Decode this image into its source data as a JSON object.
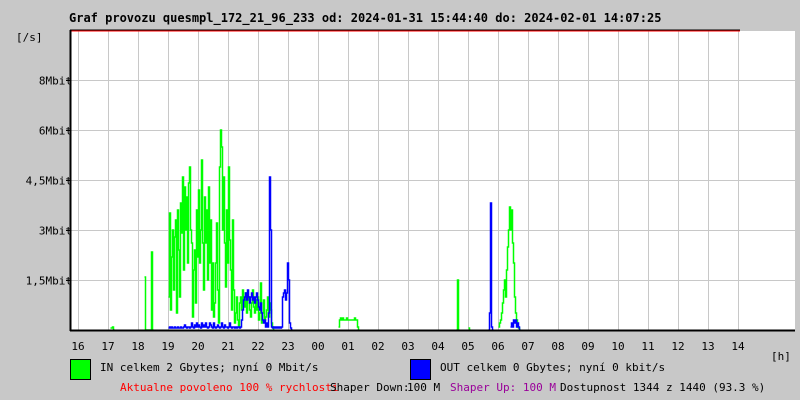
{
  "chart_data": {
    "type": "line",
    "title": "Graf provozu quesmpl_172_21_96_233 od: 2024-01-31 15:44:40 do: 2024-02-01 14:07:25",
    "ylabel": "[/s]",
    "xlabel": "[h]",
    "x_units": "hours since 16:00",
    "xlim": [
      -0.27,
      23.9
    ],
    "ylim": [
      0,
      9
    ],
    "x_ticks": [
      0,
      1,
      2,
      3,
      4,
      5,
      6,
      7,
      8,
      9,
      10,
      11,
      12,
      13,
      14,
      15,
      16,
      17,
      18,
      19,
      20,
      21,
      22
    ],
    "x_tick_labels": [
      "16",
      "17",
      "18",
      "19",
      "20",
      "21",
      "22",
      "23",
      "00",
      "01",
      "02",
      "03",
      "04",
      "05",
      "06",
      "07",
      "08",
      "09",
      "10",
      "11",
      "12",
      "13",
      "14"
    ],
    "y_ticks": [
      1.5,
      3,
      4.5,
      6,
      7.5
    ],
    "y_tick_labels": [
      "1,5Mbit",
      "3Mbit",
      "4,5Mbit",
      "6Mbit",
      "8Mbit"
    ],
    "grid": true,
    "step_hours": 0.0333,
    "series": [
      {
        "name": "IN",
        "color": "#00ff00",
        "segments": [
          {
            "start": 1.067,
            "values": [
              0.05,
              0.05,
              0.1,
              0
            ]
          },
          {
            "start": 2.2,
            "values": [
              1.59,
              0,
              0,
              0,
              0,
              0,
              0,
              2.34,
              0
            ]
          },
          {
            "start": 3.0,
            "values": [
              1.0,
              3.5,
              0.6,
              2.2,
              3.0,
              1.2,
              2.8,
              3.3,
              0.5,
              3.6,
              2.4,
              1.0,
              3.8,
              2.9,
              4.6,
              1.8,
              4.3,
              3.0,
              4.0,
              2.0,
              4.4,
              4.9,
              3.0,
              2.6,
              0.4,
              1.8,
              2.4,
              0.8,
              3.6,
              2.2,
              4.2,
              2.0,
              3.0,
              5.1,
              2.6,
              1.2,
              4.0,
              2.6,
              3.6,
              1.5,
              4.3,
              2.0,
              3.3,
              0.6,
              2.0,
              0.4,
              0.8,
              2.0,
              3.2,
              1.2,
              0.2,
              4.9,
              6.0,
              5.5,
              3.0,
              4.6,
              2.6,
              1.3,
              3.6,
              2.0,
              4.9,
              2.7,
              1.8,
              0.6,
              3.3,
              1.2,
              0.2,
              0.5,
              1.0,
              0.3,
              0.1,
              0.8,
              1.0,
              0.6,
              1.2,
              0.9,
              0.7,
              1.1,
              0.5,
              0.9,
              1.0,
              0.6,
              0.4,
              0.8,
              1.2,
              0.7,
              0.5,
              0.9,
              0.6,
              1.0,
              0.3,
              0.5,
              1.4,
              0.2,
              0.5,
              0.9,
              0.3,
              0.4,
              0.6,
              1.0,
              0.4,
              0.8,
              0.6,
              0.2,
              0.1,
              0
            ]
          },
          {
            "start": 8.667,
            "values": [
              0.1,
              0.3,
              0.35,
              0.3,
              0.35,
              0.3,
              0.3,
              0.3,
              0.35,
              0.3,
              0.3,
              0.3,
              0.3,
              0.3,
              0.3,
              0.3,
              0.35,
              0.3,
              0.3,
              0.1,
              0
            ]
          },
          {
            "start": 12.6,
            "values": [
              0,
              1.5,
              0
            ]
          },
          {
            "start": 13.0,
            "values": [
              0.05,
              0
            ]
          },
          {
            "start": 14.0,
            "values": [
              0.1,
              0.2,
              0.3,
              0.5,
              0.8,
              1.2,
              1.5,
              1.0,
              1.8,
              2.5,
              3.0,
              3.7,
              3.0,
              3.6,
              2.6,
              2.0,
              1.0,
              0.5,
              0.3,
              0.1,
              0.05,
              0
            ]
          }
        ]
      },
      {
        "name": "OUT",
        "color": "#0000ff",
        "segments": [
          {
            "start": 3.0,
            "values": [
              0.05,
              0.1,
              0.05,
              0.1,
              0.05,
              0.05,
              0.1,
              0.05,
              0.05,
              0.1,
              0.05,
              0.05,
              0.1,
              0.05,
              0.05,
              0.1,
              0.15,
              0.1,
              0.05,
              0.1,
              0.1,
              0.05,
              0.1,
              0.2,
              0.1,
              0.05,
              0.15,
              0.1,
              0.2,
              0.1,
              0.15,
              0.1,
              0.05,
              0.2,
              0.1,
              0.15,
              0.1,
              0.2,
              0.1,
              0.05,
              0.1,
              0.2,
              0.15,
              0.1,
              0.05,
              0.2,
              0.1,
              0.05,
              0.1,
              0.15,
              0.1,
              0.05,
              0.1,
              0.2,
              0.1,
              0.05,
              0.15,
              0.1,
              0.1,
              0.05,
              0.1,
              0.2,
              0.1,
              0.05,
              0.1,
              0.1,
              0.05,
              0.1,
              0.05,
              0.1,
              0.1,
              0.05,
              0.1,
              0.3,
              0.6,
              0.9,
              1.0,
              1.1,
              0.9,
              1.2,
              1.0,
              0.8,
              1.0,
              1.1,
              0.9,
              1.0,
              0.8,
              1.0,
              1.1,
              0.9,
              0.7,
              0.6,
              0.8,
              0.5,
              0.3,
              0.2,
              0.3,
              0.1,
              0.2,
              0.1,
              0.5,
              4.6,
              3.0,
              0.1,
              0.05,
              0.1,
              0.05,
              0.1,
              0.05,
              0.1,
              0.05,
              0.1,
              0.05,
              0.1,
              1.0,
              1.1,
              1.2,
              0.9,
              1.1,
              2.0,
              1.5,
              0.2,
              0.05,
              0
            ]
          },
          {
            "start": 13.667,
            "values": [
              0,
              0.5,
              3.8,
              0.1,
              0
            ]
          },
          {
            "start": 14.4,
            "values": [
              0.1,
              0.2,
              0.1,
              0.3,
              0.2,
              0.3,
              0.1,
              0.2,
              0.1,
              0
            ]
          }
        ]
      }
    ]
  },
  "legend": {
    "in_label": "IN celkem 2 Gbytes; nyní 0 Mbit/s",
    "out_label": "OUT celkem 0 Gbytes; nyní 0 kbit/s",
    "in_color": "#00ff00",
    "out_color": "#0000ff"
  },
  "status": {
    "allowed": "Aktualne povoleno 100 % rychlosti",
    "shaper_down_label": "Shaper Down:",
    "shaper_down_value": "100 M",
    "shaper_up": "Shaper Up: 100 M",
    "availability": "Dostupnost 1344 z 1440 (93.3 %)"
  }
}
